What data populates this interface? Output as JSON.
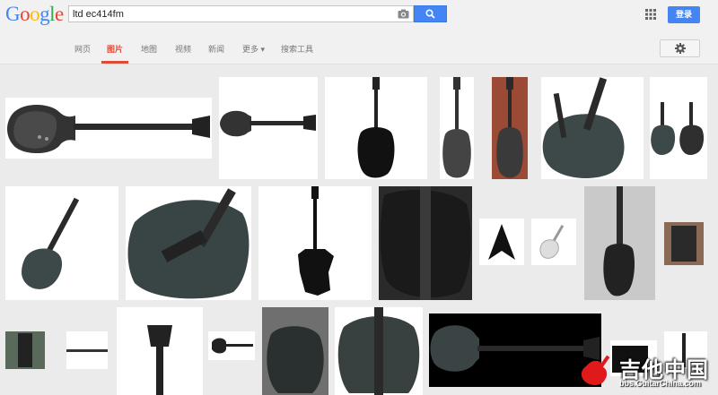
{
  "logo": {
    "text": "Google"
  },
  "search": {
    "query": "ltd ec414fm",
    "camera_icon": "camera-icon",
    "button_icon": "search-icon"
  },
  "header": {
    "apps_icon": "apps-grid-icon",
    "login_label": "登录"
  },
  "nav": {
    "tabs": [
      {
        "label": "网页",
        "active": false
      },
      {
        "label": "图片",
        "active": true
      },
      {
        "label": "地图",
        "active": false
      },
      {
        "label": "视频",
        "active": false
      },
      {
        "label": "新闻",
        "active": false
      },
      {
        "label": "更多 ▾",
        "active": false
      },
      {
        "label": "搜索工具",
        "active": false
      }
    ],
    "settings_icon": "gear-icon"
  },
  "results": {
    "row1": [
      "bass-full-black",
      "bass-full-white",
      "bass-back-black",
      "bass-upright-small",
      "bass-against-brick",
      "bass-closeup-angled",
      "bass-pair"
    ],
    "row2": [
      "bass-diagonal",
      "bass-body-closeup",
      "bass-upright-black",
      "bass-body-dark",
      "flying-v-guitar",
      "white-guitar",
      "bass-in-room",
      "bass-small-thumb"
    ],
    "row3": [
      "bass-small-1",
      "bass-neck-thin",
      "bass-headstock",
      "guitar-small",
      "bass-in-store",
      "bass-body-front",
      "bass-on-black",
      "amp-and-guitar"
    ]
  },
  "watermark": {
    "text": "吉他中国",
    "url": "bbs.GuitarChina.com"
  },
  "colors": {
    "accent": "#4485f3",
    "active_tab": "#dd4b39",
    "background": "#ebebeb"
  }
}
